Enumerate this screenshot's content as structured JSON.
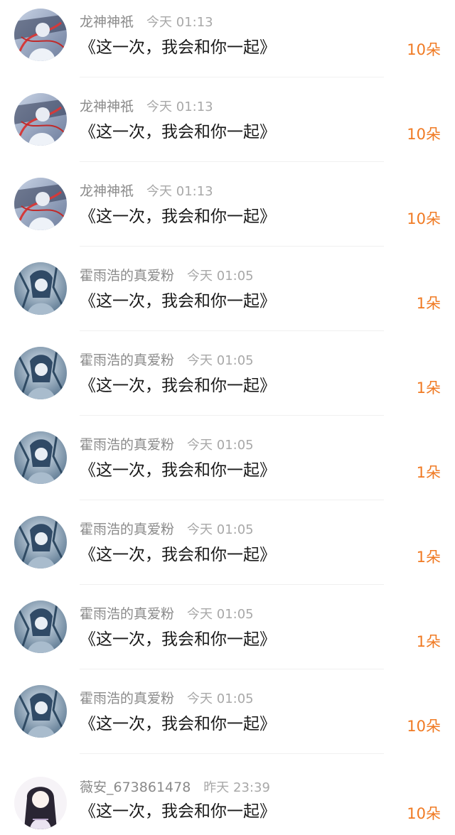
{
  "gift_list": [
    {
      "user": "龙神神祇",
      "time": "今天 01:13",
      "message": "《这一次，我会和你一起》",
      "count": "10朵",
      "avatar": "dragon-god-avatar"
    },
    {
      "user": "龙神神祇",
      "time": "今天 01:13",
      "message": "《这一次，我会和你一起》",
      "count": "10朵",
      "avatar": "dragon-god-avatar"
    },
    {
      "user": "龙神神祇",
      "time": "今天 01:13",
      "message": "《这一次，我会和你一起》",
      "count": "10朵",
      "avatar": "dragon-god-avatar"
    },
    {
      "user": "霍雨浩的真爱粉",
      "time": "今天 01:05",
      "message": "《这一次，我会和你一起》",
      "count": "1朵",
      "avatar": "fan-avatar"
    },
    {
      "user": "霍雨浩的真爱粉",
      "time": "今天 01:05",
      "message": "《这一次，我会和你一起》",
      "count": "1朵",
      "avatar": "fan-avatar"
    },
    {
      "user": "霍雨浩的真爱粉",
      "time": "今天 01:05",
      "message": "《这一次，我会和你一起》",
      "count": "1朵",
      "avatar": "fan-avatar"
    },
    {
      "user": "霍雨浩的真爱粉",
      "time": "今天 01:05",
      "message": "《这一次，我会和你一起》",
      "count": "1朵",
      "avatar": "fan-avatar"
    },
    {
      "user": "霍雨浩的真爱粉",
      "time": "今天 01:05",
      "message": "《这一次，我会和你一起》",
      "count": "1朵",
      "avatar": "fan-avatar"
    },
    {
      "user": "霍雨浩的真爱粉",
      "time": "今天 01:05",
      "message": "《这一次，我会和你一起》",
      "count": "10朵",
      "avatar": "fan-avatar"
    },
    {
      "user": "薇安_673861478",
      "time": "昨天 23:39",
      "message": "《这一次，我会和你一起》",
      "count": "10朵",
      "avatar": "vian-avatar"
    }
  ],
  "colors": {
    "accent": "#f07a23",
    "username": "#8a8a8a",
    "timestamp": "#a8a8a8",
    "message": "#1a1a1a"
  }
}
